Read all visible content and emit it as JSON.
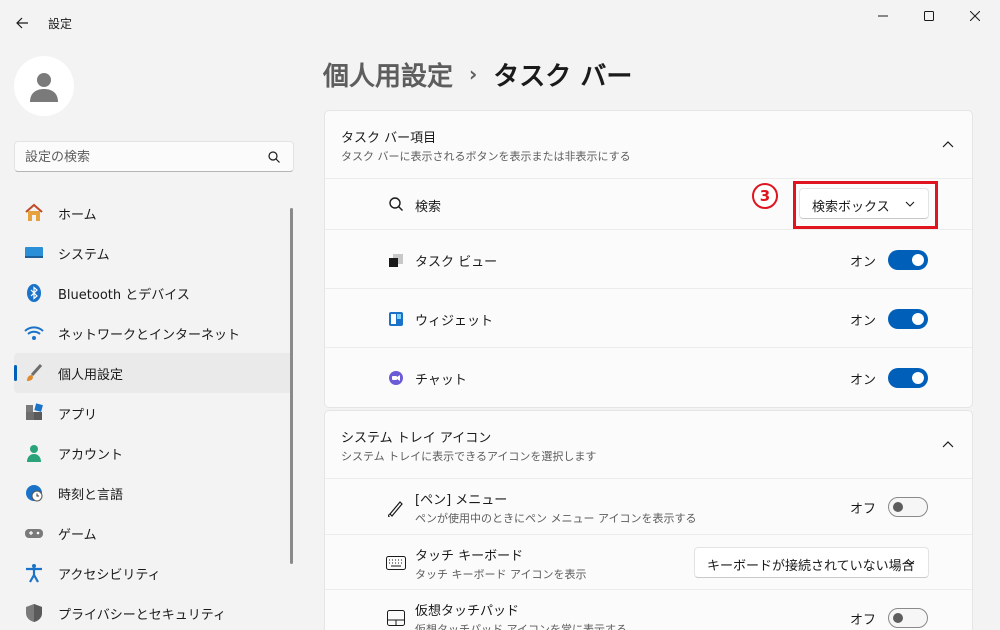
{
  "window": {
    "title": "設定"
  },
  "sidebar": {
    "search_placeholder": "設定の検索",
    "items": [
      {
        "label": "ホーム",
        "icon": "home-icon"
      },
      {
        "label": "システム",
        "icon": "system-icon"
      },
      {
        "label": "Bluetooth とデバイス",
        "icon": "bluetooth-icon"
      },
      {
        "label": "ネットワークとインターネット",
        "icon": "wifi-icon"
      },
      {
        "label": "個人用設定",
        "icon": "brush-icon",
        "active": true
      },
      {
        "label": "アプリ",
        "icon": "apps-icon"
      },
      {
        "label": "アカウント",
        "icon": "account-icon"
      },
      {
        "label": "時刻と言語",
        "icon": "clock-globe-icon"
      },
      {
        "label": "ゲーム",
        "icon": "gamepad-icon"
      },
      {
        "label": "アクセシビリティ",
        "icon": "accessibility-icon"
      },
      {
        "label": "プライバシーとセキュリティ",
        "icon": "shield-icon"
      }
    ]
  },
  "breadcrumb": {
    "parent": "個人用設定",
    "separator": "›",
    "current": "タスク バー"
  },
  "taskbar_items": {
    "title": "タスク バー項目",
    "subtitle": "タスク バーに表示されるボタンを表示または非表示にする",
    "rows": [
      {
        "label": "検索",
        "control": "dropdown",
        "value": "検索ボックス"
      },
      {
        "label": "タスク ビュー",
        "control": "toggle",
        "state_label": "オン",
        "on": true
      },
      {
        "label": "ウィジェット",
        "control": "toggle",
        "state_label": "オン",
        "on": true
      },
      {
        "label": "チャット",
        "control": "toggle",
        "state_label": "オン",
        "on": true
      }
    ]
  },
  "tray_icons": {
    "title": "システム トレイ アイコン",
    "subtitle": "システム トレイに表示できるアイコンを選択します",
    "rows": [
      {
        "label": "[ペン] メニュー",
        "desc": "ペンが使用中のときにペン メニュー アイコンを表示する",
        "control": "toggle",
        "state_label": "オフ",
        "on": false
      },
      {
        "label": "タッチ キーボード",
        "desc": "タッチ キーボード アイコンを表示",
        "control": "dropdown",
        "value": "キーボードが接続されていない場合"
      },
      {
        "label": "仮想タッチパッド",
        "desc": "仮想タッチパッド アイコンを常に表示する",
        "control": "toggle",
        "state_label": "オフ",
        "on": false
      }
    ]
  },
  "annotation": {
    "step": "3"
  },
  "colors": {
    "accent": "#005fb8",
    "highlight": "#e0141e"
  }
}
